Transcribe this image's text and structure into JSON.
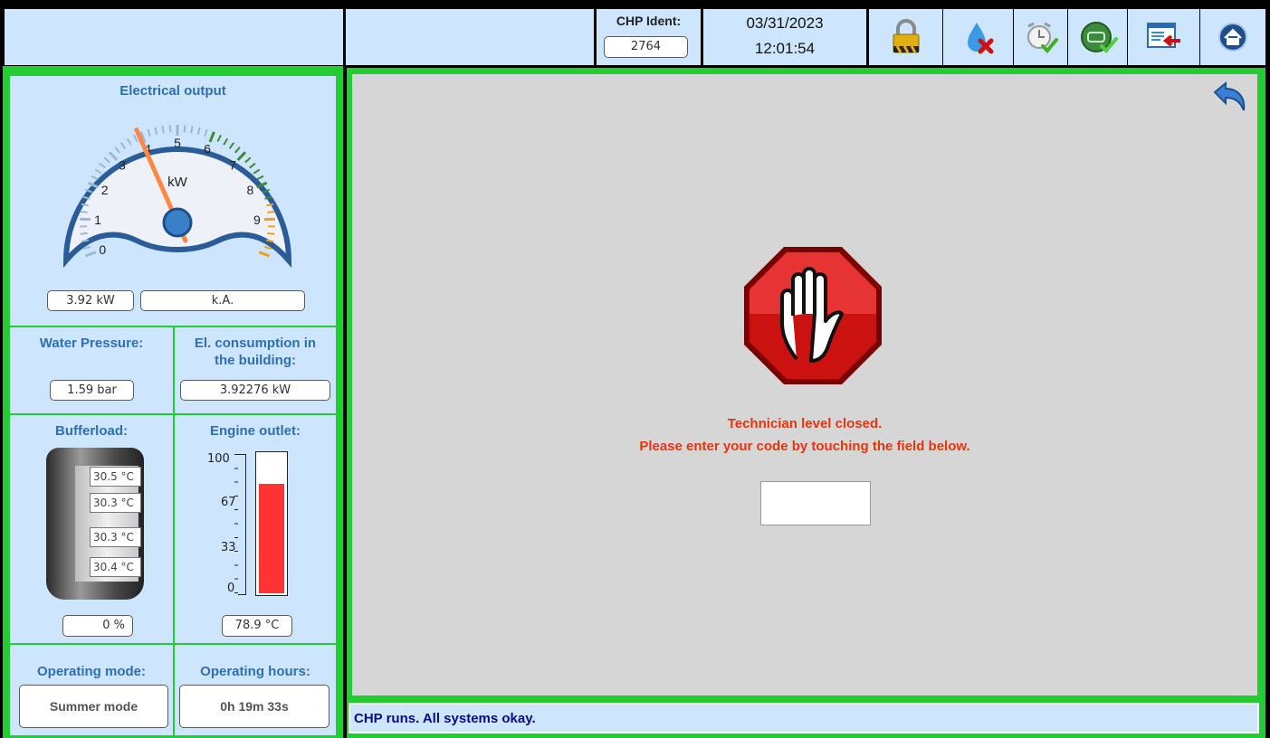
{
  "header": {
    "chp_ident_label": "CHP Ident:",
    "chp_ident_value": "2764",
    "date": "03/31/2023",
    "time": "12:01:54",
    "icons": [
      "lock-icon",
      "water-error-icon",
      "alarm-clock-ok-icon",
      "engine-ok-icon",
      "exit-window-icon",
      "home-icon"
    ]
  },
  "electrical": {
    "title": "Electrical output",
    "unit_glyph": "kW",
    "scale": [
      "0",
      "1",
      "2",
      "3",
      "4",
      "5",
      "6",
      "7",
      "8",
      "9"
    ],
    "value": 3.92,
    "max": 10,
    "value_display": "3.92 kW",
    "secondary": "k.A."
  },
  "water_pressure": {
    "label": "Water Pressure:",
    "value": "1.59 bar"
  },
  "consumption": {
    "label_line1": "El. consumption in",
    "label_line2": "the building:",
    "value": "3.92276 kW"
  },
  "bufferload": {
    "label": "Bufferload:",
    "temps": [
      "30.5 °C",
      "30.3 °C",
      "30.3 °C",
      "30.4 °C"
    ],
    "percent": "0 %"
  },
  "engine_outlet": {
    "label": "Engine outlet:",
    "ticks": [
      "100",
      "67",
      "33",
      "0"
    ],
    "level_percent": 78.9,
    "value": "78.9 °C"
  },
  "operating_mode": {
    "label": "Operating mode:",
    "value": "Summer mode"
  },
  "operating_hours": {
    "label": "Operating hours:",
    "value": "0h 19m 33s"
  },
  "main": {
    "line1": "Technician level closed.",
    "line2": "Please enter your code by touching the field below.",
    "code_value": ""
  },
  "status": {
    "text": "CHP runs. All systems okay."
  },
  "colors": {
    "panel": "#cde5fd",
    "frame_green": "#22cc33",
    "stop_red": "#cc1111",
    "bar_red": "#ff3333"
  }
}
